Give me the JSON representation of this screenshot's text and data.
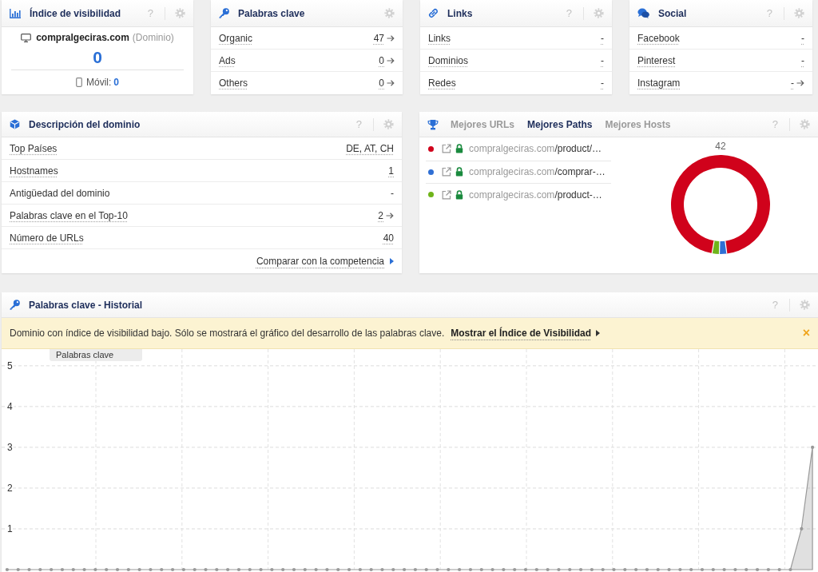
{
  "visibility": {
    "title": "Índice de visibilidad",
    "help": "?",
    "domain": "compralgeciras.com",
    "domain_type": "(Dominio)",
    "value": "0",
    "mobile_label": "Móvil:",
    "mobile_value": "0"
  },
  "keywords": {
    "title": "Palabras clave",
    "rows": [
      {
        "label": "Organic",
        "value": "47",
        "arrow": true,
        "tooltip": true
      },
      {
        "label": "Ads",
        "value": "0",
        "arrow": true,
        "tooltip": true
      },
      {
        "label": "Others",
        "value": "0",
        "arrow": true,
        "tooltip": true
      }
    ]
  },
  "links": {
    "title": "Links",
    "help": "?",
    "rows": [
      {
        "label": "Links",
        "value": "-",
        "arrow": false,
        "tooltip": true
      },
      {
        "label": "Dominios",
        "value": "-",
        "arrow": false,
        "tooltip": true
      },
      {
        "label": "Redes",
        "value": "-",
        "arrow": false,
        "tooltip": true
      }
    ]
  },
  "social": {
    "title": "Social",
    "help": "?",
    "rows": [
      {
        "label": "Facebook",
        "value": "-",
        "arrow": false,
        "tooltip": true
      },
      {
        "label": "Pinterest",
        "value": "-",
        "arrow": false,
        "tooltip": true
      },
      {
        "label": "Instagram",
        "value": "-",
        "arrow": true,
        "tooltip": true
      }
    ]
  },
  "domain_overview": {
    "title": "Descripción del dominio",
    "help": "?",
    "rows": [
      {
        "label": "Top Países",
        "value": "DE, AT, CH",
        "arrow": false,
        "tooltip": true
      },
      {
        "label": "Hostnames",
        "value": "1",
        "arrow": false,
        "tooltip": true
      },
      {
        "label": "Antigüedad del dominio",
        "value": "-",
        "arrow": false,
        "tooltip": false
      },
      {
        "label": "Palabras clave en el Top-10",
        "value": "2",
        "arrow": true,
        "tooltip": true
      },
      {
        "label": "Número de URLs",
        "value": "40",
        "arrow": false,
        "tooltip": true
      }
    ],
    "footer_link": "Comparar con la competencia"
  },
  "top_paths": {
    "help": "?",
    "tabs": [
      {
        "label": "Mejores URLs",
        "selected": false
      },
      {
        "label": "Mejores Paths",
        "selected": true
      },
      {
        "label": "Mejores Hosts",
        "selected": false
      }
    ],
    "paths": [
      {
        "color": "#d0021b",
        "domain": "compralgeciras.com",
        "path": "/product/…"
      },
      {
        "color": "#2f6fd4",
        "domain": "compralgeciras.com",
        "path": "/comprar-…"
      },
      {
        "color": "#6fb41a",
        "domain": "compralgeciras.com",
        "path": "/product-…"
      }
    ],
    "chart_data": {
      "type": "donut",
      "title": "42",
      "values": [
        95.2,
        2.4,
        2.4
      ]
    }
  },
  "history": {
    "title": "Palabras clave - Historial",
    "help": "?",
    "notice": {
      "text": "Dominio con índice de visibilidad bajo. Sólo se mostrará el gráfico del desarrollo de las palabras clave.",
      "link": "Mostrar el Índice de Visibilidad",
      "close": "×"
    },
    "chart_data": {
      "type": "area",
      "grid": true,
      "ylim": [
        0,
        6.8
      ],
      "yticks": [
        1,
        2,
        3,
        4,
        5
      ],
      "series": [
        {
          "name": "Palabras clave",
          "color": "#999999",
          "values": [
            0,
            0,
            0,
            0,
            0,
            0,
            0,
            0,
            0,
            0,
            0,
            0,
            0,
            0,
            0,
            0,
            0,
            0,
            0,
            0,
            0,
            0,
            0,
            0,
            0,
            0,
            0,
            0,
            0,
            0,
            0,
            0,
            0,
            0,
            0,
            0,
            0,
            0,
            0,
            0,
            0,
            0,
            0,
            0,
            0,
            0,
            0,
            0,
            0,
            0,
            0,
            0,
            0,
            0,
            0,
            0,
            0,
            0,
            0,
            0,
            0,
            0,
            0,
            0,
            0,
            0,
            0,
            0,
            0,
            0,
            0,
            0,
            1,
            3
          ]
        }
      ]
    }
  }
}
